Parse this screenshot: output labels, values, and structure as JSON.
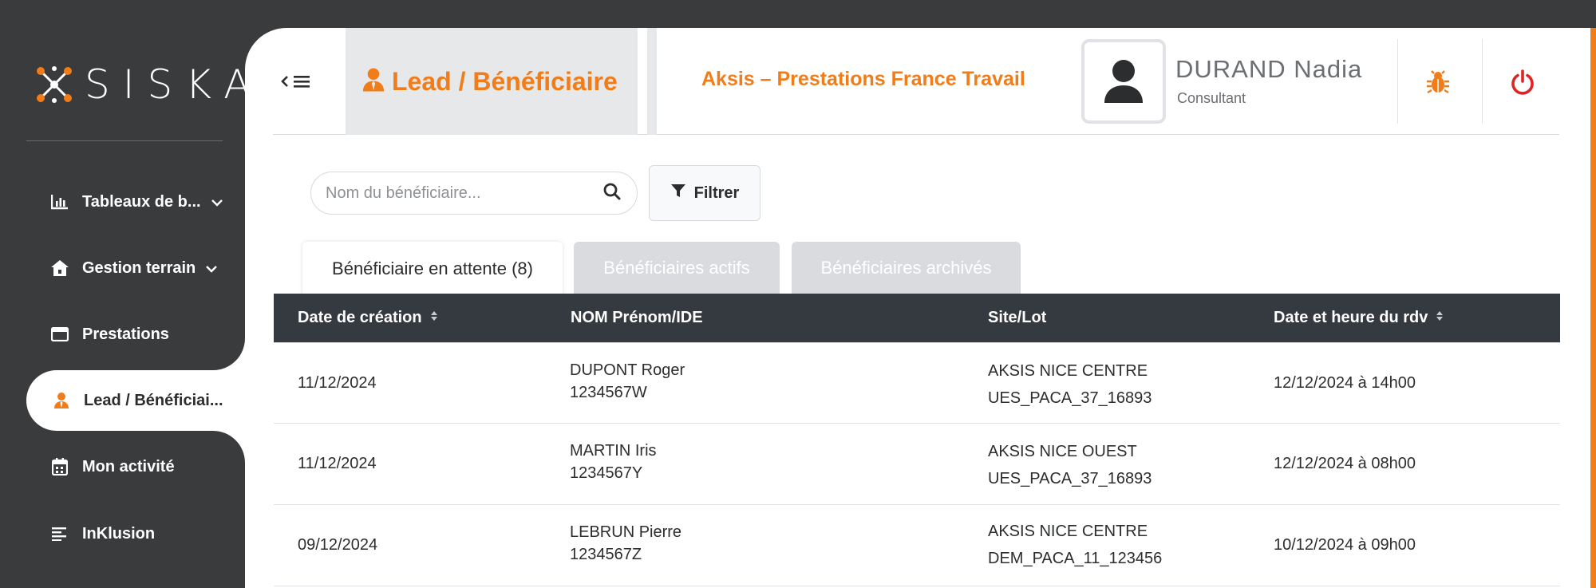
{
  "app": {
    "logo_text": "SISKA"
  },
  "sidebar": {
    "items": [
      {
        "label": "Tableaux de b...",
        "icon": "bar-chart-icon",
        "has_chevron": true
      },
      {
        "label": "Gestion terrain",
        "icon": "home-icon",
        "has_chevron": true
      },
      {
        "label": "Prestations",
        "icon": "window-icon",
        "has_chevron": false
      },
      {
        "label": "Lead / Bénéficiai...",
        "icon": "user-tie-icon",
        "has_chevron": false,
        "active": true
      },
      {
        "label": "Mon activité",
        "icon": "calendar-icon",
        "has_chevron": false
      },
      {
        "label": "InKlusion",
        "icon": "align-left-icon",
        "has_chevron": false
      }
    ]
  },
  "header": {
    "page_title": "Lead / Bénéficiaire",
    "org_name": "Aksis – Prestations France Travail",
    "user_name": "DURAND Nadia",
    "user_role": "Consultant"
  },
  "toolbar": {
    "search_placeholder": "Nom du bénéficiaire...",
    "filter_label": "Filtrer"
  },
  "tabs": [
    {
      "label": "Bénéficiaire en attente (8)",
      "active": true
    },
    {
      "label": "Bénéficiaires actifs",
      "active": false
    },
    {
      "label": "Bénéficiaires archivés",
      "active": false
    }
  ],
  "table": {
    "columns": [
      "Date de création",
      "NOM Prénom/IDE",
      "Site/Lot",
      "Date et heure du rdv"
    ],
    "rows": [
      {
        "created": "11/12/2024",
        "name": "DUPONT Roger",
        "ide": "1234567W",
        "site": "AKSIS NICE CENTRE",
        "lot": "UES_PACA_37_16893",
        "rdv": "12/12/2024 à 14h00"
      },
      {
        "created": "11/12/2024",
        "name": "MARTIN Iris",
        "ide": "1234567Y",
        "site": "AKSIS NICE OUEST",
        "lot": "UES_PACA_37_16893",
        "rdv": "12/12/2024 à 08h00"
      },
      {
        "created": "09/12/2024",
        "name": "LEBRUN Pierre",
        "ide": "1234567Z",
        "site": "AKSIS NICE CENTRE",
        "lot": "DEM_PACA_11_123456",
        "rdv": "10/12/2024 à 09h00"
      }
    ]
  },
  "colors": {
    "accent": "#f07d1a",
    "sidebar": "#3a3b3d",
    "table_header": "#343a40",
    "danger": "#e02424"
  }
}
